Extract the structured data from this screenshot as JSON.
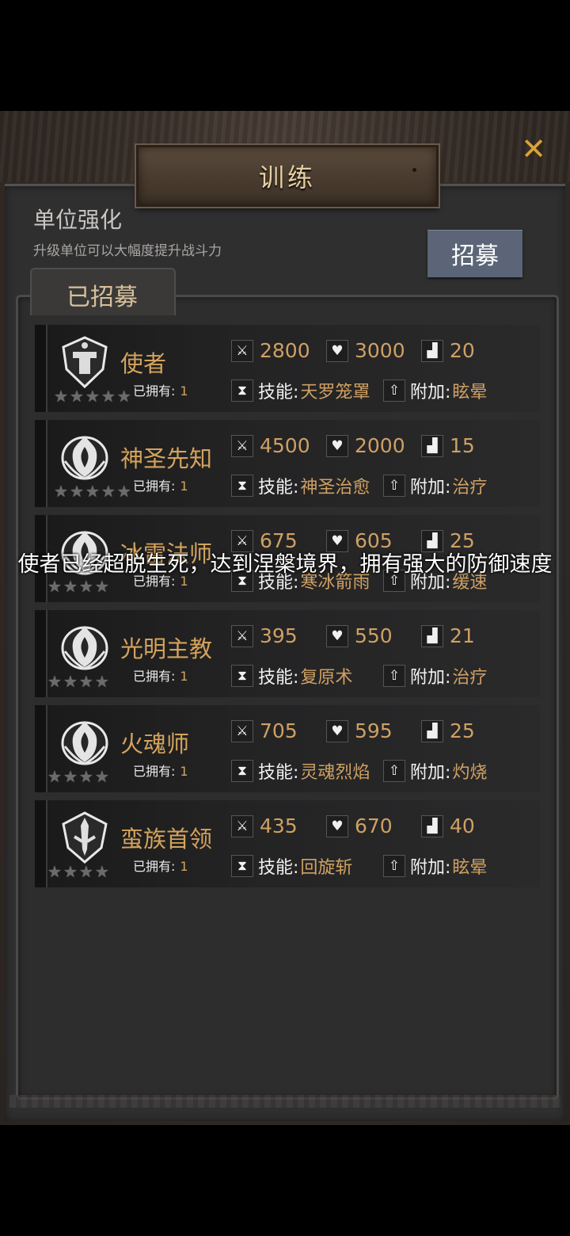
{
  "window": {
    "title": "训练",
    "close_icon": "close-x-icon",
    "accent": "#d8a23a"
  },
  "section": {
    "title": "单位强化",
    "subtitle": "升级单位可以大幅度提升战斗力",
    "recruit_button": "招募",
    "tab_label": "已招募"
  },
  "labels": {
    "owned": "已拥有:",
    "skill": "技能:",
    "extra": "附加:"
  },
  "units": [
    {
      "name": "使者",
      "owned": "1",
      "attack": "2800",
      "health": "3000",
      "speed": "20",
      "skill": "天罗笼罩",
      "extra": "眩晕",
      "emblem": "helmet-emblem-icon",
      "stars": 5
    },
    {
      "name": "神圣先知",
      "owned": "1",
      "attack": "4500",
      "health": "2000",
      "speed": "15",
      "skill": "神圣治愈",
      "extra": "治疗",
      "emblem": "flame-emblem-icon",
      "stars": 5
    },
    {
      "name": "冰雷法师",
      "owned": "1",
      "attack": "675",
      "health": "605",
      "speed": "25",
      "skill": "寒冰箭雨",
      "extra": "缓速",
      "emblem": "flame-emblem-icon",
      "stars": 4
    },
    {
      "name": "光明主教",
      "owned": "1",
      "attack": "395",
      "health": "550",
      "speed": "21",
      "skill": "复原术",
      "extra": "治疗",
      "emblem": "flame-emblem-icon",
      "stars": 4
    },
    {
      "name": "火魂师",
      "owned": "1",
      "attack": "705",
      "health": "595",
      "speed": "25",
      "skill": "灵魂烈焰",
      "extra": "灼烧",
      "emblem": "flame-emblem-icon",
      "stars": 4
    },
    {
      "name": "蛮族首领",
      "owned": "1",
      "attack": "435",
      "health": "670",
      "speed": "40",
      "skill": "回旋斩",
      "extra": "眩晕",
      "emblem": "sword-emblem-icon",
      "stars": 4
    }
  ],
  "toast": "使者已经超脱生死，达到涅槃境界，拥有强大的防御速度"
}
